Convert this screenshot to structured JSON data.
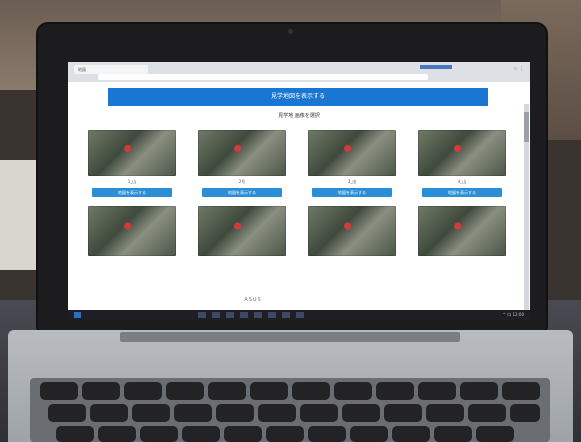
{
  "browser": {
    "tab_label": "地図",
    "icons": "☆ ⋮"
  },
  "page": {
    "banner": "見学地図を表示する",
    "subtitle": "見学地 画像を選択",
    "tiles_row1": [
      {
        "label": "1_山",
        "button": "地図を表示する"
      },
      {
        "label": "2号",
        "button": "地図を表示する"
      },
      {
        "label": "3_出",
        "button": "地図を表示する"
      },
      {
        "label": "4_山",
        "button": "地図を表示する"
      }
    ]
  },
  "taskbar": {
    "tray": "^ 口 12:00"
  },
  "laptop": {
    "brand": "ASUS"
  }
}
